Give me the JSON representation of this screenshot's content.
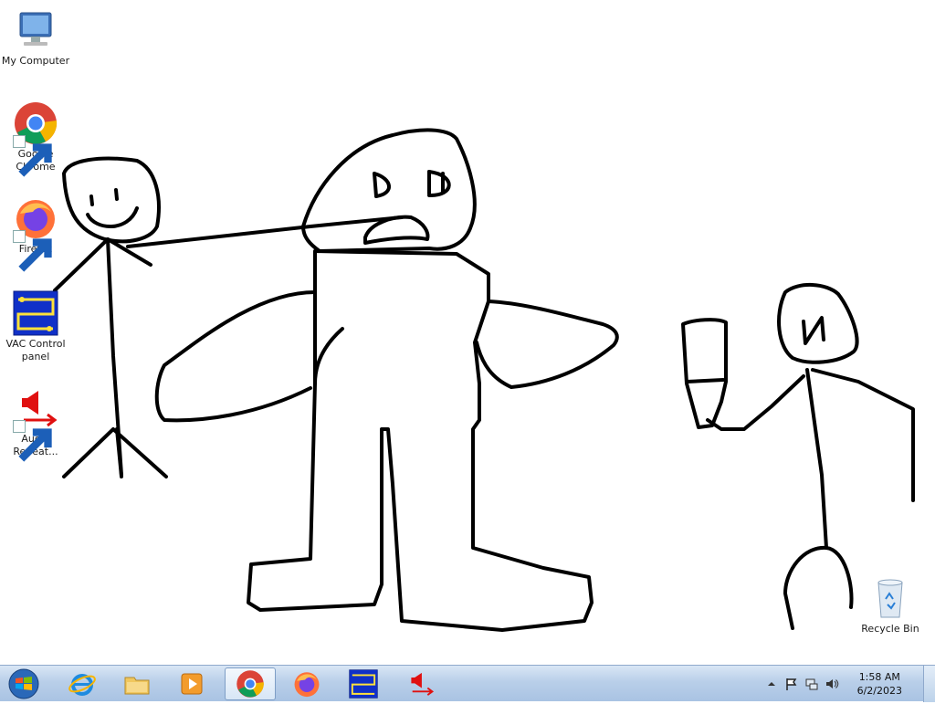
{
  "desktop": {
    "icons": [
      {
        "label": "My Computer",
        "icon": "computer-icon",
        "shortcut": false
      },
      {
        "label": "Google Chrome",
        "icon": "chrome-icon",
        "shortcut": true
      },
      {
        "label": "Firefox",
        "icon": "firefox-icon",
        "shortcut": true
      },
      {
        "label": "VAC Control panel",
        "icon": "vac-icon",
        "shortcut": false
      },
      {
        "label": "Audio Repeat...",
        "icon": "audio-repeater-icon",
        "shortcut": true
      },
      {
        "label": "Recycle Bin",
        "icon": "recycle-bin-icon",
        "shortcut": false
      }
    ]
  },
  "taskbar": {
    "start_icon": "windows-start-icon",
    "pinned": [
      {
        "name": "internet-explorer",
        "icon": "ie-icon",
        "active": false
      },
      {
        "name": "file-explorer",
        "icon": "folder-icon",
        "active": false
      },
      {
        "name": "media-player",
        "icon": "media-player-icon",
        "active": false
      },
      {
        "name": "google-chrome",
        "icon": "chrome-icon",
        "active": true
      },
      {
        "name": "firefox",
        "icon": "firefox-icon",
        "active": false
      },
      {
        "name": "vac-control-panel",
        "icon": "vac-icon",
        "active": false
      },
      {
        "name": "audio-repeater",
        "icon": "audio-repeater-icon",
        "active": false
      }
    ],
    "tray": {
      "icons": [
        "show-hidden-icons-arrow",
        "action-center-flag-icon",
        "network-icon",
        "volume-icon"
      ],
      "time": "1:58 AM",
      "date": "6/2/2023"
    }
  },
  "colors": {
    "taskbar": "#b9cfe9",
    "wallpaper": "#ffffff",
    "sketch_stroke": "#000000"
  }
}
